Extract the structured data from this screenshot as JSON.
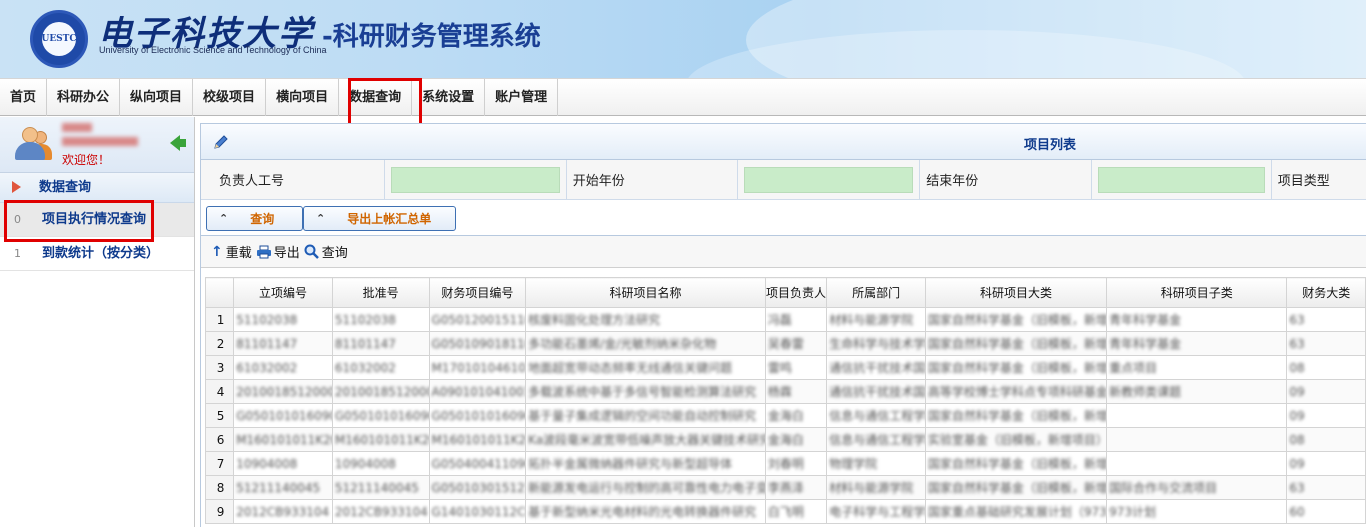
{
  "header": {
    "logo_text": "UESTC",
    "school_name": "电子科技大学",
    "school_name_en": "University of Electronic Science and Technology of China",
    "system_title": "-科研财务管理系统"
  },
  "nav": {
    "items": [
      "首页",
      "科研办公",
      "纵向项目",
      "校级项目",
      "横向项目",
      "数据查询",
      "系统设置",
      "账户管理"
    ],
    "highlighted": "数据查询"
  },
  "sidebar": {
    "welcome": "欢迎您！",
    "section_title": "数据查询",
    "items": [
      {
        "index": "0",
        "label": "项目执行情况查询",
        "highlighted": true
      },
      {
        "index": "1",
        "label": "到款统计（按分类）",
        "highlighted": false
      }
    ]
  },
  "panel": {
    "title": "项目列表",
    "filters": {
      "leader_id_label": "负责人工号",
      "start_year_label": "开始年份",
      "end_year_label": "结束年份",
      "project_type_label": "项目类型"
    },
    "buttons": {
      "query": "查询",
      "export_summary": "导出上帐汇总单"
    },
    "toolbar": {
      "reload": "重载",
      "export": "导出",
      "search": "查询"
    }
  },
  "table": {
    "columns": [
      "立项编号",
      "批准号",
      "财务项目编号",
      "科研项目名称",
      "项目负责人",
      "所属部门",
      "科研项目大类",
      "科研项目子类",
      "财务大类"
    ],
    "rows": [
      {
        "n": "1",
        "cells": [
          "51102038",
          "51102038",
          "G0501200151102",
          "核废料固化处理方法研究",
          "冯磊",
          "材料与能源学院",
          "国家自然科学基金（旧模板，新增）",
          "青年科学基金",
          "63"
        ]
      },
      {
        "n": "2",
        "cells": [
          "81101147",
          "81101147",
          "G0501090181101",
          "多功能石墨烯/金/光敏剂纳米杂化物",
          "吴春雷",
          "生命科学与技术学院",
          "国家自然科学基金（旧模板，新增）",
          "青年科学基金",
          "63"
        ]
      },
      {
        "n": "3",
        "cells": [
          "61032002",
          "61032002",
          "M1701010461032",
          "地面超宽带动态频率无线通信关键问题",
          "雷鸣",
          "通信抗干扰技术国家",
          "国家自然科学基金（旧模板，新增）",
          "重点项目",
          "08"
        ]
      },
      {
        "n": "4",
        "cells": [
          "20100185120007",
          "20100185120007",
          "A0901010410018",
          "多载波系统中基于多信号智能检测算法研究",
          "杨霖",
          "通信抗干扰技术国家",
          "高等学校博士学科点专项科研基金",
          "新教师类课题",
          "09"
        ]
      },
      {
        "n": "5",
        "cells": [
          "G0501010160901",
          "G0501010160901",
          "G0501010160901",
          "基于量子集成逻辑的空间功能自动控制研究",
          "金海白",
          "信息与通信工程学院",
          "国家自然科学基金（旧模板，新增）",
          "",
          "09"
        ]
      },
      {
        "n": "6",
        "cells": [
          "M160101011K201",
          "M160101011K201",
          "M160101011K201",
          "Ka波段毫米波宽带低噪声放大器关键技术研究",
          "金海白",
          "信息与通信工程学院",
          "实验室基金（旧模板，新增项目）",
          "",
          "08"
        ]
      },
      {
        "n": "7",
        "cells": [
          "10904008",
          "10904008",
          "G0504004110904",
          "拓扑半金属微纳器件研究与新型超导体",
          "刘春明",
          "物理学院",
          "国家自然科学基金（旧模板，新增）",
          "",
          "09"
        ]
      },
      {
        "n": "8",
        "cells": [
          "51211140045",
          "51211140045",
          "G0501030151211",
          "新能源发电运行与控制的高可靠性电力电子变换技术",
          "李燕泽",
          "材料与能源学院",
          "国家自然科学基金（旧模板，新增）",
          "国际合作与交流项目",
          "63"
        ]
      },
      {
        "n": "9",
        "cells": [
          "2012CB933104",
          "2012CB933104",
          "G1401030112CB",
          "基于新型纳米光电材料的光电转换器件研究",
          "白飞明",
          "电子科学与工程学院",
          "国家重点基础研究发展计划（973）",
          "973计划",
          "60"
        ]
      }
    ]
  }
}
